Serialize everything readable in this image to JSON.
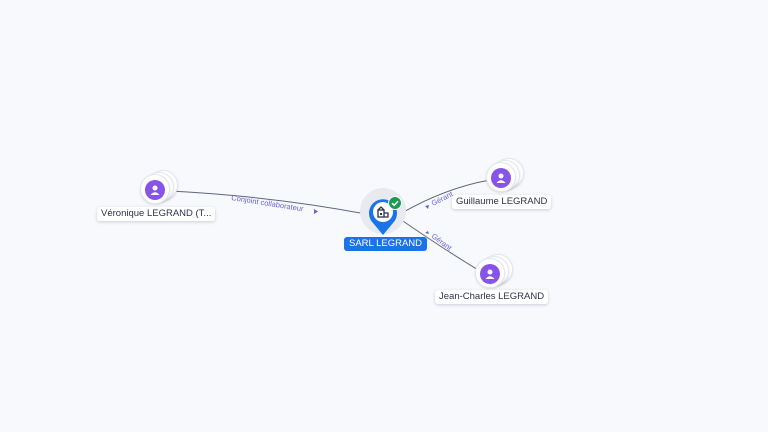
{
  "company": {
    "name": "SARL LEGRAND",
    "verified_icon": "check-badge-icon",
    "icon": "building-icon",
    "label_color": "#1a73e8"
  },
  "people": [
    {
      "name": "Véronique LEGRAND (T...",
      "icon": "person-icon"
    },
    {
      "name": "Guillaume LEGRAND",
      "icon": "person-icon"
    },
    {
      "name": "Jean-Charles LEGRAND",
      "icon": "person-icon"
    }
  ],
  "relations": [
    {
      "label": "Conjoint collaborateur"
    },
    {
      "label": "Gérant"
    },
    {
      "label": "Gérant"
    }
  ],
  "colors": {
    "person_node": "#8854e8",
    "edge_label": "#6a5fd8",
    "verified": "#1a9b52"
  }
}
